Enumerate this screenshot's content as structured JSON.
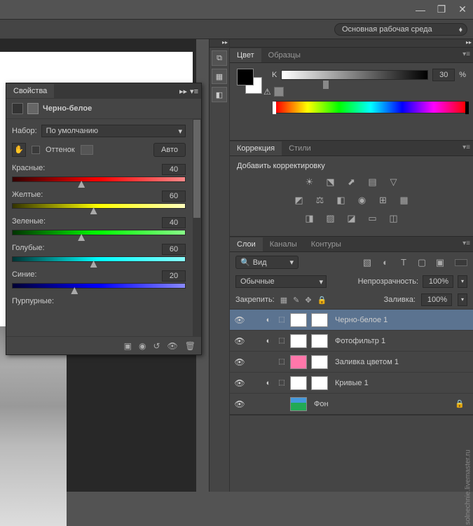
{
  "titlebar": {
    "min": "—",
    "max": "❐",
    "close": "✕"
  },
  "workspace": {
    "label": "Основная рабочая среда"
  },
  "color_panel": {
    "tabs": {
      "color": "Цвет",
      "swatches": "Образцы"
    },
    "k_label": "K",
    "k_value": "30",
    "pct": "%"
  },
  "adjustments_panel": {
    "tabs": {
      "adj": "Коррекция",
      "styles": "Стили"
    },
    "title": "Добавить корректировку"
  },
  "layers_panel": {
    "tabs": {
      "layers": "Слои",
      "channels": "Каналы",
      "paths": "Контуры"
    },
    "kind": "Вид",
    "blend": "Обычные",
    "opacity_label": "Непрозрачность:",
    "opacity": "100%",
    "lock_label": "Закрепить:",
    "fill_label": "Заливка:",
    "fill": "100%",
    "items": [
      {
        "name": "Черно-белое 1",
        "sel": true,
        "fx": true,
        "link": true,
        "mask": true,
        "thumb": "white"
      },
      {
        "name": "Фотофильтр 1",
        "fx": true,
        "link": true,
        "mask": true,
        "thumb": "white"
      },
      {
        "name": "Заливка цветом 1",
        "link": true,
        "mask": true,
        "thumb": "pink"
      },
      {
        "name": "Кривые 1",
        "fx": true,
        "link": true,
        "mask": true,
        "thumb": "white"
      },
      {
        "name": "Фон",
        "lock": true,
        "thumb": "photo"
      }
    ]
  },
  "props": {
    "tab": "Свойства",
    "title": "Черно-белое",
    "preset_label": "Набор:",
    "preset": "По умолчанию",
    "tint": "Оттенок",
    "auto": "Авто",
    "sliders": [
      {
        "label": "Красные:",
        "val": "40",
        "cls": "red-grad",
        "pos": 40
      },
      {
        "label": "Желтые:",
        "val": "60",
        "cls": "yel-grad",
        "pos": 47
      },
      {
        "label": "Зеленые:",
        "val": "40",
        "cls": "grn-grad",
        "pos": 40
      },
      {
        "label": "Голубые:",
        "val": "60",
        "cls": "cyn-grad",
        "pos": 47
      },
      {
        "label": "Синие:",
        "val": "20",
        "cls": "blu-grad",
        "pos": 36
      },
      {
        "label": "Пурпурные:",
        "val": "",
        "cls": "",
        "pos": 0,
        "hidden": true
      }
    ]
  },
  "watermark": "solnechnie.livemaster.ru"
}
